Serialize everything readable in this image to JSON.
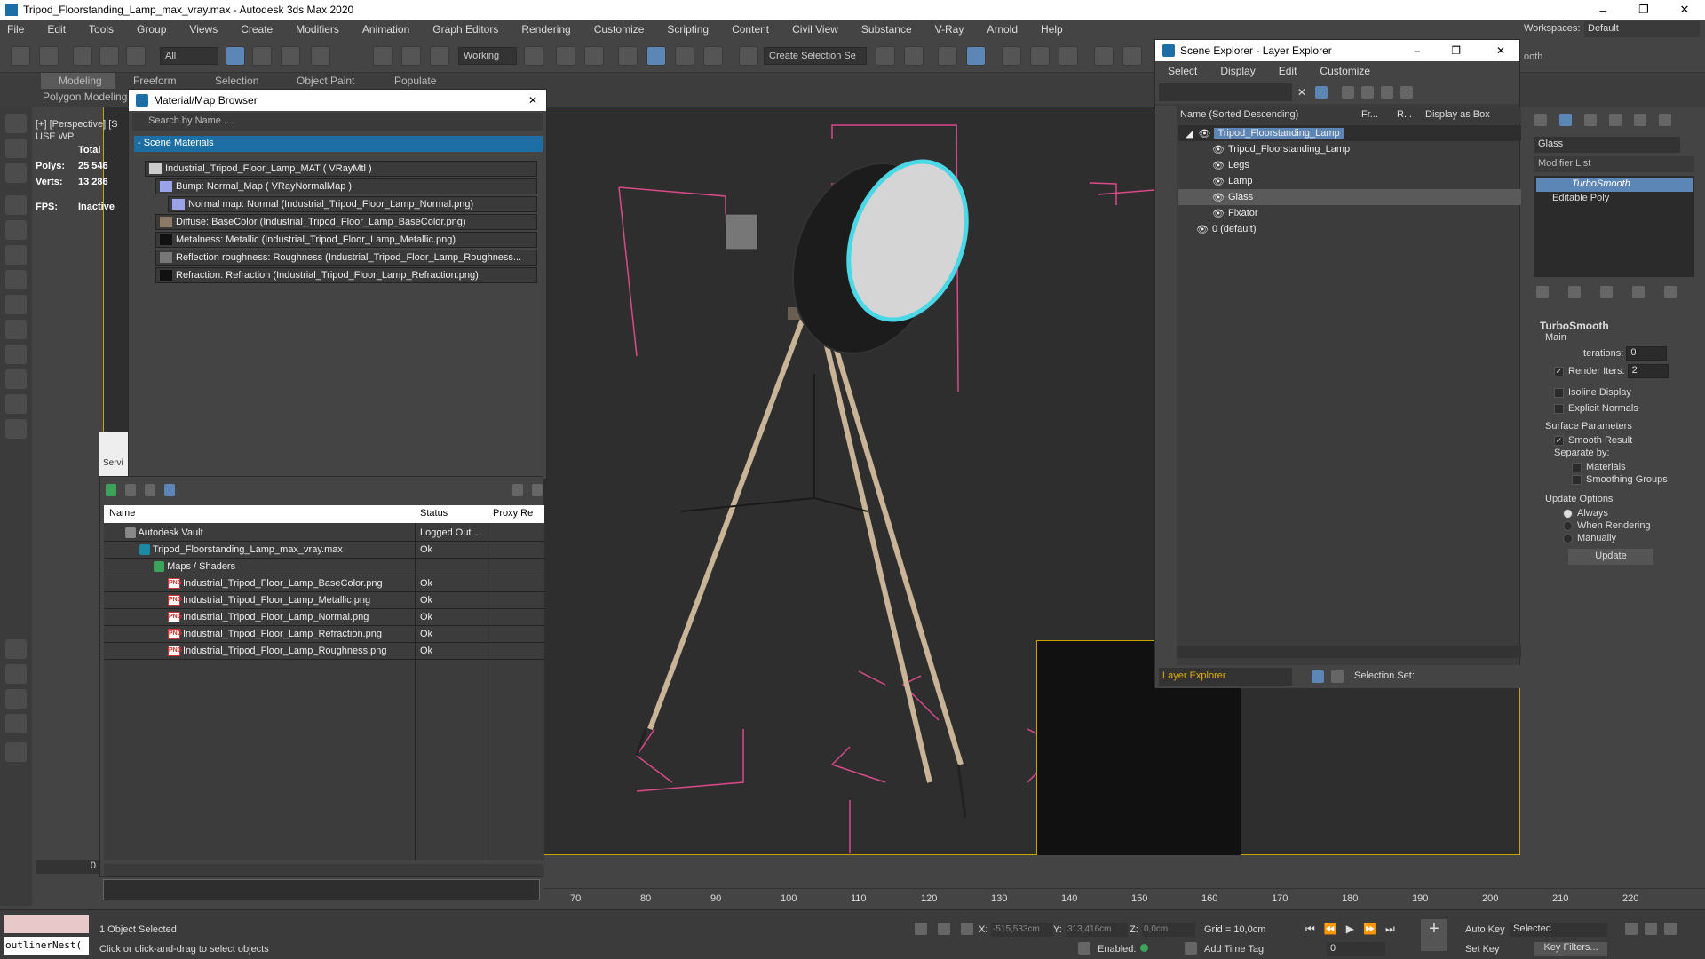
{
  "window": {
    "title": "Tripod_Floorstanding_Lamp_max_vray.max - Autodesk 3ds Max 2020",
    "min": "–",
    "max": "❐",
    "close": "✕"
  },
  "menu": [
    "File",
    "Edit",
    "Tools",
    "Group",
    "Views",
    "Create",
    "Modifiers",
    "Animation",
    "Graph Editors",
    "Rendering",
    "Customize",
    "Scripting",
    "Content",
    "Civil View",
    "Substance",
    "V-Ray",
    "Arnold",
    "Help"
  ],
  "workspace": {
    "label": "Workspaces:",
    "value": "Default"
  },
  "toolbar": {
    "filter": "All",
    "layer": "Working",
    "selection_set": "Create Selection Se"
  },
  "ribbon": {
    "tabs": [
      "Modeling",
      "Freeform",
      "Selection",
      "Object Paint",
      "Populate"
    ],
    "sub": "Polygon Modeling"
  },
  "viewport": {
    "label": "[+] [Perspective] [S",
    "sublabel": "USE WP",
    "stats": {
      "total": "Total",
      "polys_label": "Polys:",
      "polys": "25 546",
      "verts_label": "Verts:",
      "verts": "13 286",
      "fps_label": "FPS:",
      "fps": "Inactive"
    }
  },
  "material_browser": {
    "title": "Material/Map Browser",
    "search": "Search by Name ...",
    "group": "- Scene Materials",
    "rows": [
      "Industrial_Tripod_Floor_Lamp_MAT ( VRayMtl )",
      "Bump: Normal_Map  ( VRayNormalMap )",
      "Normal map: Normal (Industrial_Tripod_Floor_Lamp_Normal.png)",
      "Diffuse: BaseColor (Industrial_Tripod_Floor_Lamp_BaseColor.png)",
      "Metalness: Metallic (Industrial_Tripod_Floor_Lamp_Metallic.png)",
      "Reflection roughness: Roughness (Industrial_Tripod_Floor_Lamp_Roughness...",
      "Refraction: Refraction (Industrial_Tripod_Floor_Lamp_Refraction.png)"
    ]
  },
  "asset_tracking": {
    "tab": "Servi",
    "cols": [
      "Name",
      "Status",
      "Proxy Re"
    ],
    "rows": [
      {
        "name": "Autodesk Vault",
        "status": "Logged Out ..."
      },
      {
        "name": "Tripod_Floorstanding_Lamp_max_vray.max",
        "status": "Ok"
      },
      {
        "name": "Maps / Shaders",
        "status": ""
      },
      {
        "name": "Industrial_Tripod_Floor_Lamp_BaseColor.png",
        "status": "Ok"
      },
      {
        "name": "Industrial_Tripod_Floor_Lamp_Metallic.png",
        "status": "Ok"
      },
      {
        "name": "Industrial_Tripod_Floor_Lamp_Normal.png",
        "status": "Ok"
      },
      {
        "name": "Industrial_Tripod_Floor_Lamp_Refraction.png",
        "status": "Ok"
      },
      {
        "name": "Industrial_Tripod_Floor_Lamp_Roughness.png",
        "status": "Ok"
      }
    ],
    "png_badge": "PNG"
  },
  "scene_explorer": {
    "title": "Scene Explorer - Layer Explorer",
    "menu": [
      "Select",
      "Display",
      "Edit",
      "Customize"
    ],
    "cols": [
      "Name (Sorted Descending)",
      "Fr...",
      "R...",
      "Display as Box"
    ],
    "rows": [
      "Tripod_Floorstanding_Lamp",
      "Tripod_Floorstanding_Lamp",
      "Legs",
      "Lamp",
      "Glass",
      "Fixator",
      "0 (default)"
    ],
    "footer": "Layer Explorer",
    "selset": "Selection Set:",
    "right_text": "ooth"
  },
  "command_panel": {
    "object_name": "Glass",
    "modifier_list": "Modifier List",
    "stack": [
      "TurboSmooth",
      "Editable Poly"
    ],
    "rollout": "TurboSmooth",
    "main": "Main",
    "iterations_label": "Iterations:",
    "iterations": "0",
    "render_iters_label": "Render Iters:",
    "render_iters": "2",
    "isoline": "Isoline Display",
    "explicit": "Explicit Normals",
    "surface": "Surface Parameters",
    "smooth_result": "Smooth Result",
    "separate": "Separate by:",
    "materials": "Materials",
    "smoothing_groups": "Smoothing Groups",
    "update_options": "Update Options",
    "always": "Always",
    "when_rendering": "When Rendering",
    "manually": "Manually",
    "update": "Update"
  },
  "timeline": {
    "ticks": [
      "70",
      "80",
      "90",
      "100",
      "110",
      "120",
      "130",
      "140",
      "150",
      "160",
      "170",
      "180",
      "190",
      "200",
      "210",
      "220"
    ],
    "frame": "0"
  },
  "status": {
    "selected": "1 Object Selected",
    "hint": "Click or click-and-drag to select objects",
    "script": "outlinerNest(",
    "x_label": "X:",
    "x": "-515,533cm",
    "y_label": "Y:",
    "y": "313,416cm",
    "z_label": "Z:",
    "z": "0,0cm",
    "grid": "Grid = 10,0cm",
    "enabled": "Enabled:",
    "add_time_tag": "Add Time Tag",
    "auto_key": "Auto Key",
    "set_key": "Set Key",
    "selected_dd": "Selected",
    "key_filters": "Key Filters...",
    "frame_field": "0"
  }
}
